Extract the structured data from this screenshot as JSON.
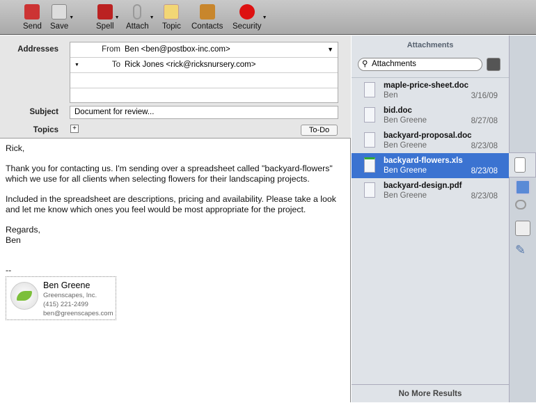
{
  "toolbar": {
    "items": [
      {
        "label": "Send",
        "icon": "send-icon"
      },
      {
        "label": "Save",
        "icon": "save-icon"
      },
      {
        "label": "Spell",
        "icon": "spell-icon"
      },
      {
        "label": "Attach",
        "icon": "paperclip-icon"
      },
      {
        "label": "Topic",
        "icon": "topic-icon"
      },
      {
        "label": "Contacts",
        "icon": "contacts-icon"
      },
      {
        "label": "Security",
        "icon": "security-icon"
      }
    ]
  },
  "header": {
    "addresses_label": "Addresses",
    "from_label": "From",
    "from_value": "Ben <ben@postbox-inc.com>",
    "to_label": "To",
    "to_value": "Rick Jones <rick@ricksnursery.com>",
    "subject_label": "Subject",
    "subject_value": "Document for review...",
    "topics_label": "Topics",
    "todo_label": "To-Do"
  },
  "body": {
    "greeting": "Rick,",
    "p1": "Thank you for contacting us.  I'm sending over a spreadsheet called \"backyard-flowers\" which we use for all clients when selecting flowers for their landscaping projects.",
    "p2": "Included in the spreadsheet are descriptions, pricing and availability.  Please take a look and let me know which ones you feel would be most appropriate for the project.",
    "closing": "Regards,",
    "name": "Ben",
    "sep": "--"
  },
  "signature": {
    "name": "Ben Greene",
    "company": "Greenscapes, Inc.",
    "phone": "(415) 221-2499",
    "email": "ben@greenscapes.com"
  },
  "attachments": {
    "title": "Attachments",
    "search_placeholder": "Attachments",
    "footer": "No More Results",
    "items": [
      {
        "name": "maple-price-sheet.doc",
        "sender": "Ben",
        "date": "3/16/09"
      },
      {
        "name": "bid.doc",
        "sender": "Ben Greene",
        "date": "8/27/08"
      },
      {
        "name": "backyard-proposal.doc",
        "sender": "Ben Greene",
        "date": "8/23/08"
      },
      {
        "name": "backyard-flowers.xls",
        "sender": "Ben Greene",
        "date": "8/23/08",
        "selected": true
      },
      {
        "name": "backyard-design.pdf",
        "sender": "Ben Greene",
        "date": "8/23/08"
      }
    ]
  }
}
